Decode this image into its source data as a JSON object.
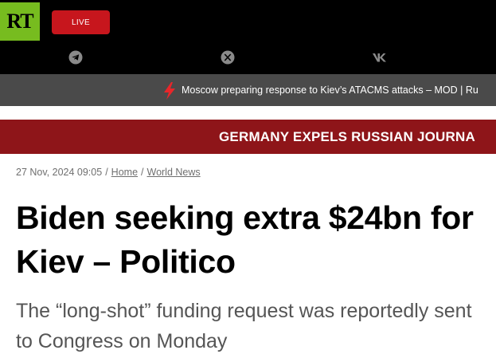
{
  "header": {
    "logo_text": "RT",
    "live_label": "LIVE",
    "social_icons": [
      "telegram-icon",
      "x-icon",
      "vk-icon"
    ]
  },
  "ticker": {
    "text": "Moscow preparing response to Kiev’s ATACMS attacks – MOD | Ru"
  },
  "banner": {
    "text": "GERMANY EXPELS RUSSIAN JOURNA"
  },
  "article": {
    "date": "27 Nov, 2024 09:05",
    "breadcrumb": [
      "Home",
      "World News"
    ],
    "headline": "Biden seeking extra $24bn for Kiev – Politico",
    "lede": "The “long-shot” funding request was reportedly sent to Congress on Monday"
  },
  "colors": {
    "brand_green": "#77bc1f",
    "live_red": "#c7161d",
    "banner_red": "#8e1519",
    "ticker_gray": "#4a4a4a"
  }
}
